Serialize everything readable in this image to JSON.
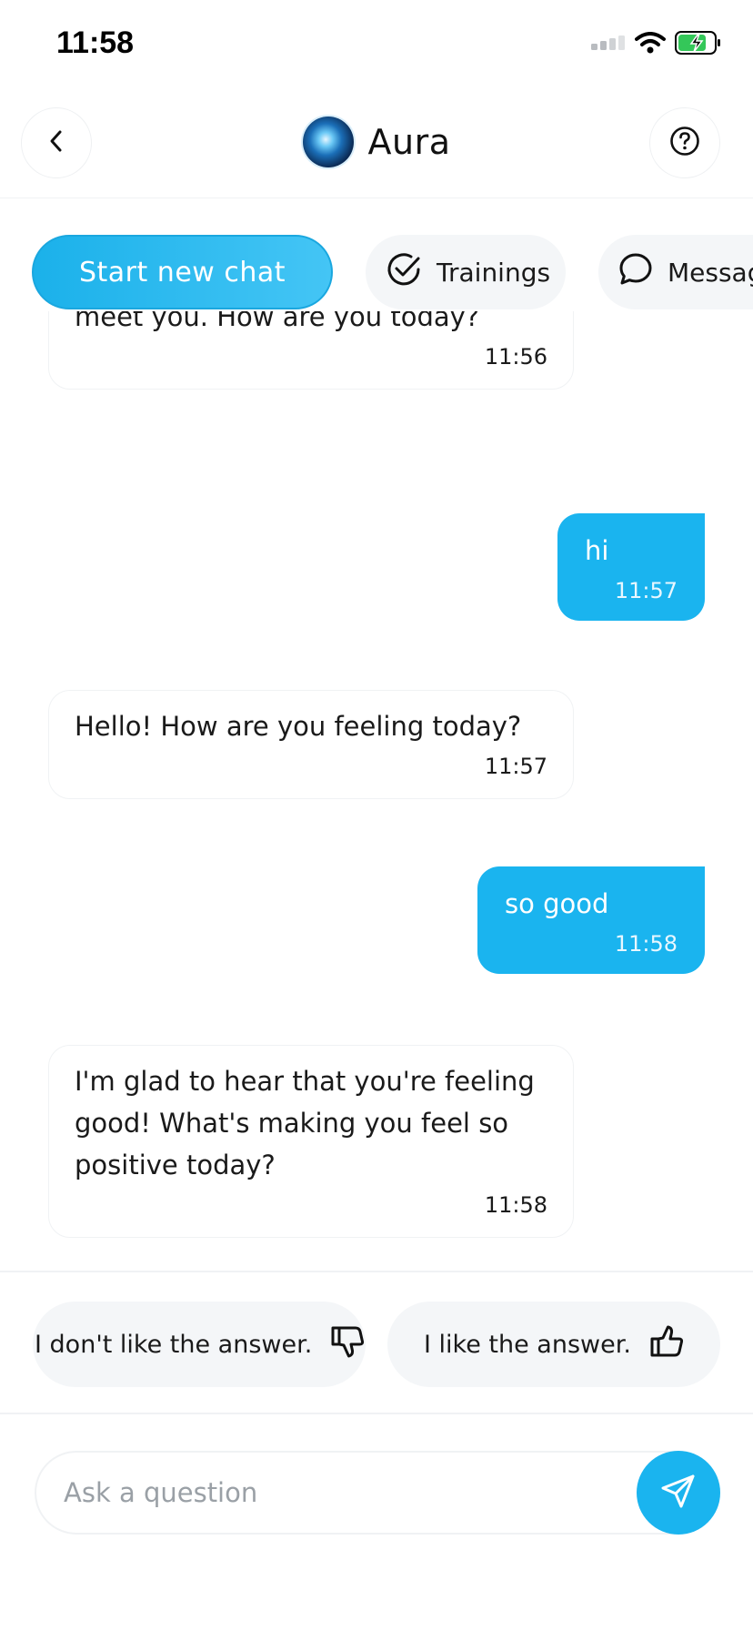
{
  "status_bar": {
    "time": "11:58"
  },
  "header": {
    "title": "Aura"
  },
  "chips": {
    "start_new_chat": "Start new chat",
    "trainings": "Trainings",
    "messages": "Messages"
  },
  "messages": [
    {
      "sender": "bot",
      "text": "meet you. How are you today?",
      "time": "11:56"
    },
    {
      "sender": "user",
      "text": "hi",
      "time": "11:57"
    },
    {
      "sender": "bot",
      "text": "Hello! How are you feeling today?",
      "time": "11:57"
    },
    {
      "sender": "user",
      "text": "so good",
      "time": "11:58"
    },
    {
      "sender": "bot",
      "text": "I'm glad to hear that you're feeling good! What's making you feel so positive today?",
      "time": "11:58"
    }
  ],
  "feedback": {
    "dislike": "I don't like the answer.",
    "like": "I like the answer."
  },
  "composer": {
    "placeholder": "Ask a question"
  },
  "colors": {
    "accent": "#1ab4ef",
    "chip_bg": "#f4f6f8",
    "battery": "#34c759"
  },
  "icons": {
    "back": "chevron-left-icon",
    "help": "question-circle-icon",
    "trainings": "check-circle-icon",
    "messages": "chat-bubble-icon",
    "dislike": "thumbs-down-icon",
    "like": "thumbs-up-icon",
    "send": "paper-plane-icon"
  }
}
